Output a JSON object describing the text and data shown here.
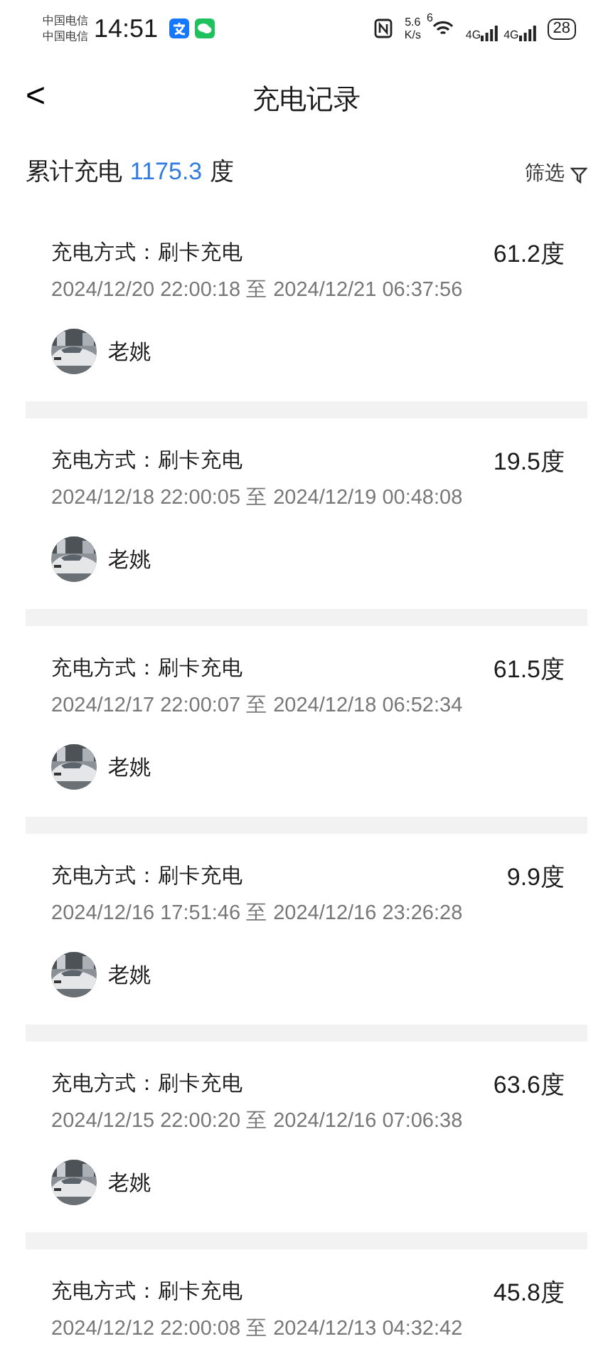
{
  "status_bar": {
    "carriers": [
      "中国电信",
      "中国电信"
    ],
    "time": "14:51",
    "speed_value": "5.6",
    "speed_unit": "K/s",
    "wifi_generation": "6",
    "network_types": [
      "4G",
      "4G"
    ],
    "battery": "28"
  },
  "header": {
    "back": "<",
    "title": "充电记录"
  },
  "summary": {
    "label": "累计充电",
    "value": "1175.3",
    "unit": "度",
    "filter": "筛选"
  },
  "records": [
    {
      "method": "充电方式：刷卡充电",
      "amount": "61.2度",
      "period": "2024/12/20 22:00:18 至 2024/12/21 06:37:56",
      "user": "老姚"
    },
    {
      "method": "充电方式：刷卡充电",
      "amount": "19.5度",
      "period": "2024/12/18 22:00:05 至 2024/12/19 00:48:08",
      "user": "老姚"
    },
    {
      "method": "充电方式：刷卡充电",
      "amount": "61.5度",
      "period": "2024/12/17 22:00:07 至 2024/12/18 06:52:34",
      "user": "老姚"
    },
    {
      "method": "充电方式：刷卡充电",
      "amount": "9.9度",
      "period": "2024/12/16 17:51:46 至 2024/12/16 23:26:28",
      "user": "老姚"
    },
    {
      "method": "充电方式：刷卡充电",
      "amount": "63.6度",
      "period": "2024/12/15 22:00:20 至 2024/12/16 07:06:38",
      "user": "老姚"
    },
    {
      "method": "充电方式：刷卡充电",
      "amount": "45.8度",
      "period": "2024/12/12 22:00:08 至 2024/12/13 04:32:42"
    }
  ]
}
